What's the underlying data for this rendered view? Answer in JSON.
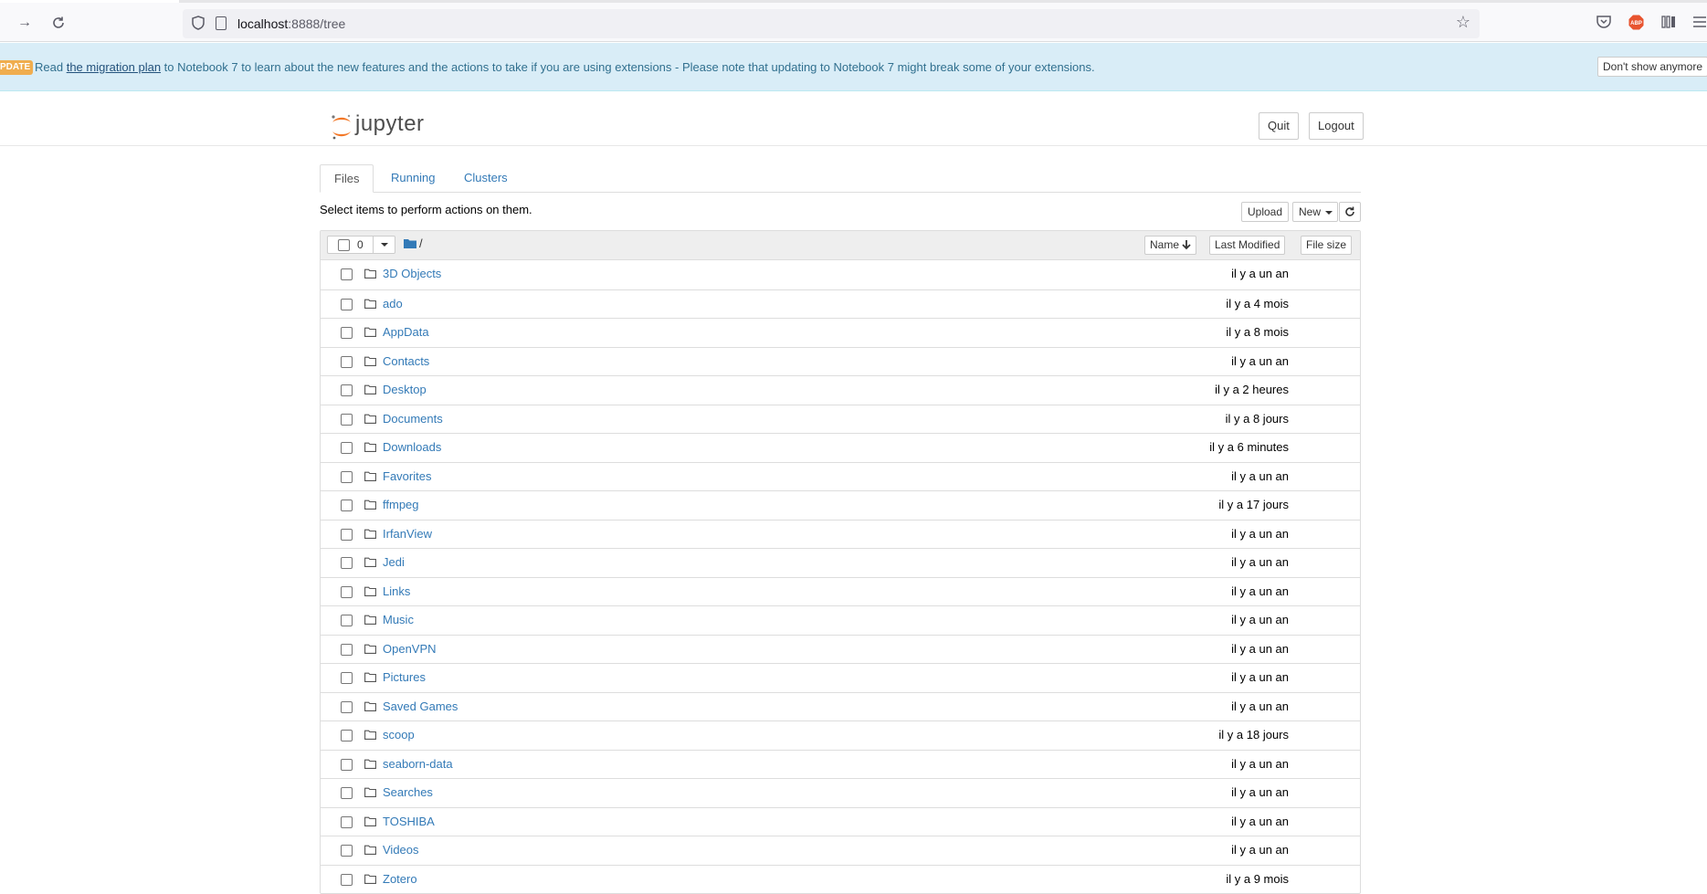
{
  "browser": {
    "url_host": "localhost",
    "url_path": ":8888/tree",
    "icons": [
      "back-icon",
      "forward-icon",
      "reload-icon",
      "shield-icon",
      "page-icon",
      "bookmark-star-icon",
      "pocket-icon",
      "adblock-icon",
      "library-icon",
      "menu-icon"
    ]
  },
  "banner": {
    "badge": "PDATE",
    "text_before": "Read ",
    "link": "the migration plan",
    "text_after": " to Notebook 7 to learn about the new features and the actions to take if you are using extensions - Please note that updating to Notebook 7 might break some of your extensions.",
    "dismiss_label": "Don't show anymore"
  },
  "header": {
    "logo_text": "jupyter",
    "quit_label": "Quit",
    "logout_label": "Logout"
  },
  "tabs": [
    {
      "label": "Files",
      "active": true
    },
    {
      "label": "Running",
      "active": false
    },
    {
      "label": "Clusters",
      "active": false
    }
  ],
  "toolbar": {
    "instruction": "Select items to perform actions on them.",
    "upload_label": "Upload",
    "new_label": "New"
  },
  "list_header": {
    "selected_count": "0",
    "path": "/",
    "sort_name": "Name",
    "sort_modified": "Last Modified",
    "sort_size": "File size"
  },
  "items": [
    {
      "name": "3D Objects",
      "modified": "il y a un an"
    },
    {
      "name": "ado",
      "modified": "il y a 4 mois"
    },
    {
      "name": "AppData",
      "modified": "il y a 8 mois"
    },
    {
      "name": "Contacts",
      "modified": "il y a un an"
    },
    {
      "name": "Desktop",
      "modified": "il y a 2 heures"
    },
    {
      "name": "Documents",
      "modified": "il y a 8 jours"
    },
    {
      "name": "Downloads",
      "modified": "il y a 6 minutes"
    },
    {
      "name": "Favorites",
      "modified": "il y a un an"
    },
    {
      "name": "ffmpeg",
      "modified": "il y a 17 jours"
    },
    {
      "name": "IrfanView",
      "modified": "il y a un an"
    },
    {
      "name": "Jedi",
      "modified": "il y a un an"
    },
    {
      "name": "Links",
      "modified": "il y a un an"
    },
    {
      "name": "Music",
      "modified": "il y a un an"
    },
    {
      "name": "OpenVPN",
      "modified": "il y a un an"
    },
    {
      "name": "Pictures",
      "modified": "il y a un an"
    },
    {
      "name": "Saved Games",
      "modified": "il y a un an"
    },
    {
      "name": "scoop",
      "modified": "il y a 18 jours"
    },
    {
      "name": "seaborn-data",
      "modified": "il y a un an"
    },
    {
      "name": "Searches",
      "modified": "il y a un an"
    },
    {
      "name": "TOSHIBA",
      "modified": "il y a un an"
    },
    {
      "name": "Videos",
      "modified": "il y a un an"
    },
    {
      "name": "Zotero",
      "modified": "il y a 9 mois"
    }
  ],
  "colors": {
    "link": "#337ab7",
    "banner_bg": "#d9edf7",
    "badge": "#f0ad4e",
    "jupyter_orange": "#f37726"
  }
}
